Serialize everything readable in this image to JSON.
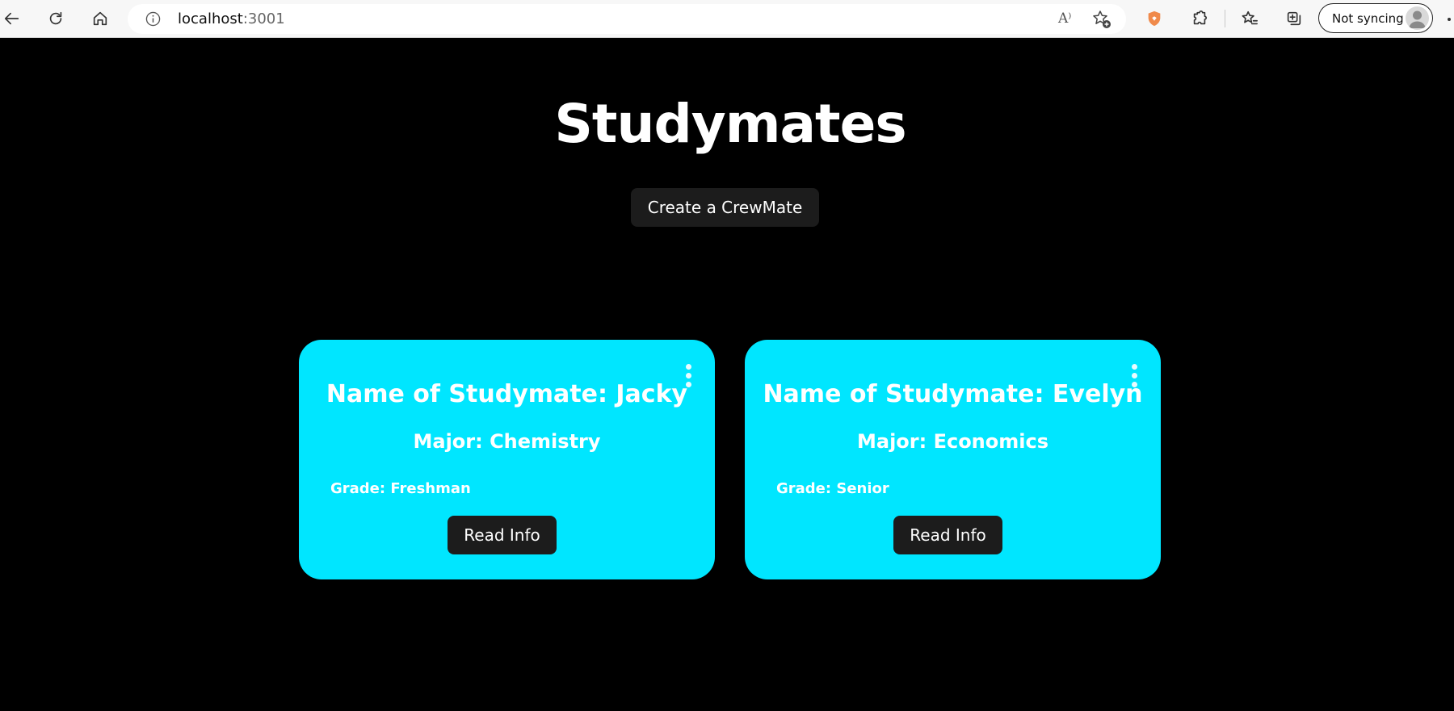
{
  "browser": {
    "url_host": "localhost",
    "url_port": ":3001",
    "read_aloud_glyph": "A⁾",
    "sync_label": "Not syncing"
  },
  "page": {
    "title": "Studymates",
    "create_button_label": "Create a CrewMate"
  },
  "cards": [
    {
      "name": "Name of Studymate: Jacky",
      "major": "Major: Chemistry",
      "grade": "Grade: Freshman",
      "button_label": "Read Info"
    },
    {
      "name": "Name of Studymate: Evelyn",
      "major": "Major: Economics",
      "grade": "Grade: Senior",
      "button_label": "Read Info"
    }
  ],
  "colors": {
    "page_background": "#000000",
    "card_background": "#00e6ff",
    "button_background": "#1c1c1c",
    "brave_shield": "#f08a4b"
  },
  "icons": {
    "toolbar": [
      "back-icon",
      "refresh-icon",
      "home-icon",
      "info-icon",
      "read-aloud-icon",
      "add-favorite-icon",
      "shield-icon",
      "extensions-icon",
      "favorites-icon",
      "collections-icon",
      "avatar-icon",
      "more-icon"
    ],
    "card": [
      "kebab-menu-icon"
    ]
  }
}
